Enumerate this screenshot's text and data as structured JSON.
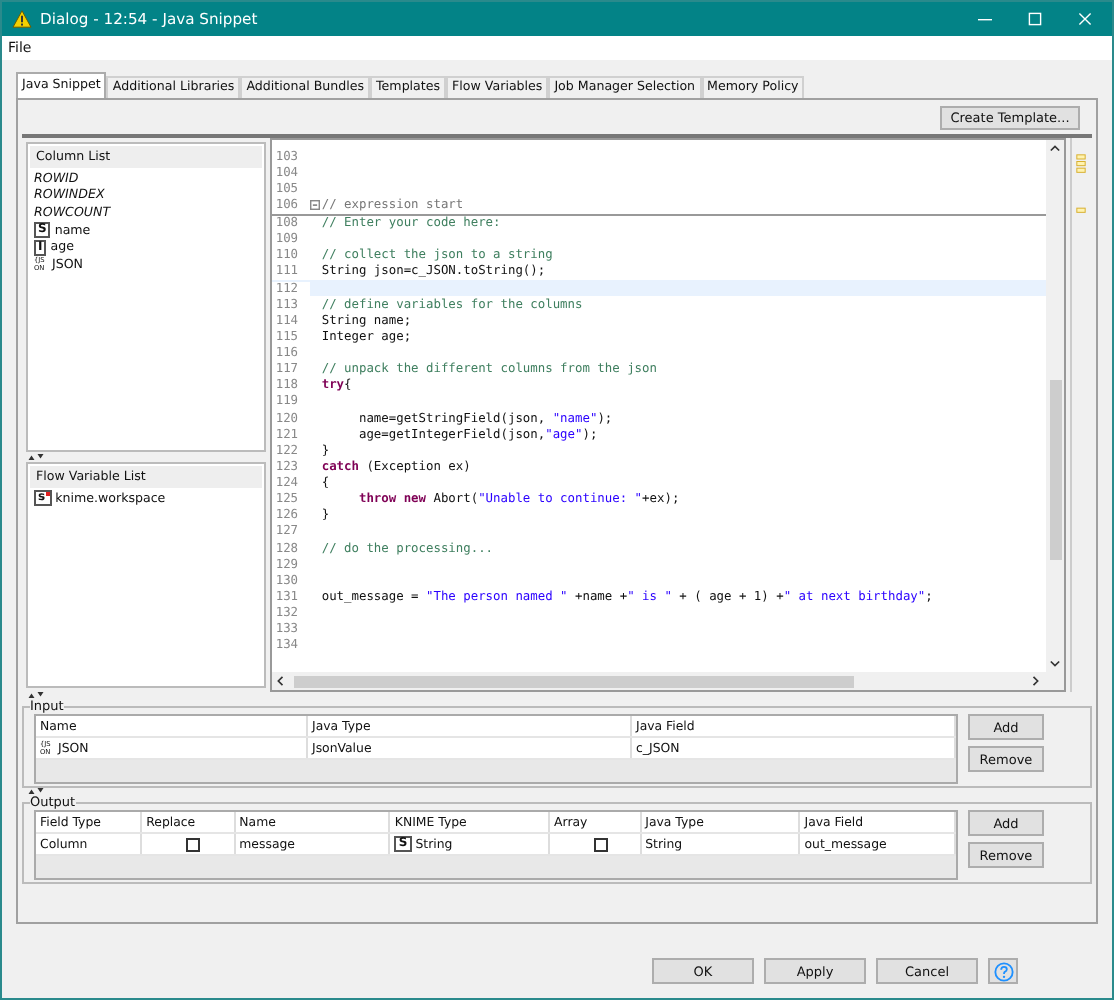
{
  "window": {
    "title": "Dialog - 12:54 - Java Snippet"
  },
  "menu": [
    "File"
  ],
  "tabs": [
    {
      "label": "Java Snippet",
      "selected": true
    },
    {
      "label": "Additional Libraries",
      "selected": false
    },
    {
      "label": "Additional Bundles",
      "selected": false
    },
    {
      "label": "Templates",
      "selected": false
    },
    {
      "label": "Flow Variables",
      "selected": false
    },
    {
      "label": "Job Manager Selection",
      "selected": false
    },
    {
      "label": "Memory Policy",
      "selected": false
    }
  ],
  "create_template_button": "Create Template...",
  "column_list": {
    "title": "Column List",
    "items": [
      {
        "kind": "special",
        "label": "ROWID"
      },
      {
        "kind": "special",
        "label": "ROWINDEX"
      },
      {
        "kind": "special",
        "label": "ROWCOUNT"
      },
      {
        "kind": "typed",
        "type": "S",
        "label": "name"
      },
      {
        "kind": "typed",
        "type": "I",
        "label": "age"
      },
      {
        "kind": "typed",
        "type": "{JS ON",
        "label": "JSON"
      }
    ]
  },
  "flow_variable_list": {
    "title": "Flow Variable List",
    "items": [
      {
        "type": "s",
        "label": "knime.workspace"
      }
    ]
  },
  "editor": {
    "lines": [
      {
        "number": "103",
        "kind": "plain"
      },
      {
        "number": "104",
        "kind": "plain"
      },
      {
        "number": "105",
        "kind": "plain"
      },
      {
        "number": "106",
        "kind": "fold",
        "tokens": [
          {
            "kind": "guard",
            "text": "// expression start"
          }
        ]
      },
      {
        "number": "108",
        "kind": "plain",
        "tokens": [
          {
            "kind": "comment",
            "text": "// Enter your code here:"
          }
        ]
      },
      {
        "number": "109",
        "kind": "plain"
      },
      {
        "number": "110",
        "kind": "plain",
        "tokens": [
          {
            "kind": "comment",
            "text": "// collect the json to a string"
          }
        ]
      },
      {
        "number": "111",
        "kind": "plain",
        "tokens": [
          {
            "kind": "plain",
            "text": "String json=c_JSON.toString();"
          }
        ]
      },
      {
        "number": "112",
        "kind": "current"
      },
      {
        "number": "113",
        "kind": "plain",
        "tokens": [
          {
            "kind": "comment",
            "text": "// define variables for the columns"
          }
        ]
      },
      {
        "number": "114",
        "kind": "plain",
        "tokens": [
          {
            "kind": "plain",
            "text": "String name;"
          }
        ]
      },
      {
        "number": "115",
        "kind": "plain",
        "tokens": [
          {
            "kind": "plain",
            "text": "Integer age;"
          }
        ]
      },
      {
        "number": "116",
        "kind": "plain"
      },
      {
        "number": "117",
        "kind": "plain",
        "tokens": [
          {
            "kind": "comment",
            "text": "// unpack the different columns from the json"
          }
        ]
      },
      {
        "number": "118",
        "kind": "plain",
        "tokens": [
          {
            "kind": "keyword",
            "text": "try"
          },
          {
            "kind": "plain",
            "text": "{"
          }
        ]
      },
      {
        "number": "119",
        "kind": "plain"
      },
      {
        "number": "120",
        "kind": "plain",
        "tokens": [
          {
            "kind": "plain",
            "text": "     name=getStringField(json, "
          },
          {
            "kind": "string",
            "text": "\"name\""
          },
          {
            "kind": "plain",
            "text": ");"
          }
        ]
      },
      {
        "number": "121",
        "kind": "plain",
        "tokens": [
          {
            "kind": "plain",
            "text": "     age=getIntegerField(json,"
          },
          {
            "kind": "string",
            "text": "\"age\""
          },
          {
            "kind": "plain",
            "text": ");"
          }
        ]
      },
      {
        "number": "122",
        "kind": "plain",
        "tokens": [
          {
            "kind": "plain",
            "text": "}"
          }
        ]
      },
      {
        "number": "123",
        "kind": "plain",
        "tokens": [
          {
            "kind": "keyword",
            "text": "catch"
          },
          {
            "kind": "plain",
            "text": " (Exception ex)"
          }
        ]
      },
      {
        "number": "124",
        "kind": "plain",
        "tokens": [
          {
            "kind": "plain",
            "text": "{"
          }
        ]
      },
      {
        "number": "125",
        "kind": "plain",
        "tokens": [
          {
            "kind": "keyword",
            "text": "     throw new"
          },
          {
            "kind": "plain",
            "text": " Abort("
          },
          {
            "kind": "string",
            "text": "\"Unable to continue: \""
          },
          {
            "kind": "plain",
            "text": "+ex);"
          }
        ]
      },
      {
        "number": "126",
        "kind": "plain",
        "tokens": [
          {
            "kind": "plain",
            "text": "}"
          }
        ]
      },
      {
        "number": "127",
        "kind": "plain"
      },
      {
        "number": "128",
        "kind": "plain",
        "tokens": [
          {
            "kind": "comment",
            "text": "// do the processing..."
          }
        ]
      },
      {
        "number": "129",
        "kind": "plain"
      },
      {
        "number": "130",
        "kind": "plain"
      },
      {
        "number": "131",
        "kind": "plain",
        "tokens": [
          {
            "kind": "plain",
            "text": "out_message = "
          },
          {
            "kind": "string",
            "text": "\"The person named \""
          },
          {
            "kind": "plain",
            "text": " +name +"
          },
          {
            "kind": "string",
            "text": "\" is \""
          },
          {
            "kind": "plain",
            "text": " + ( age + 1) +"
          },
          {
            "kind": "string",
            "text": "\" at next birthday\""
          },
          {
            "kind": "plain",
            "text": ";"
          }
        ]
      },
      {
        "number": "132",
        "kind": "plain"
      },
      {
        "number": "133",
        "kind": "plain"
      },
      {
        "number": "134",
        "kind": "plain"
      }
    ]
  },
  "input": {
    "title": "Input",
    "columns": [
      "Name",
      "Java Type",
      "Java Field"
    ],
    "rows": [
      [
        {
          "kind": "typed",
          "type": "{JS ON",
          "text": "JSON"
        },
        {
          "kind": "text",
          "text": "JsonValue"
        },
        {
          "kind": "text",
          "text": "c_JSON"
        }
      ]
    ],
    "buttons": [
      "Add",
      "Remove"
    ]
  },
  "output": {
    "title": "Output",
    "columns": [
      "Field Type",
      "Replace",
      "Name",
      "KNIME Type",
      "Array",
      "Java Type",
      "Java Field"
    ],
    "rows": [
      [
        {
          "kind": "text",
          "text": "Column"
        },
        {
          "kind": "checkbox",
          "checked": false
        },
        {
          "kind": "text",
          "text": "message"
        },
        {
          "kind": "typed",
          "type": "S",
          "text": "String"
        },
        {
          "kind": "checkbox",
          "checked": false
        },
        {
          "kind": "text",
          "text": "String"
        },
        {
          "kind": "text",
          "text": "out_message"
        }
      ]
    ],
    "buttons": [
      "Add",
      "Remove"
    ]
  },
  "footer_buttons": [
    "OK",
    "Apply",
    "Cancel"
  ]
}
